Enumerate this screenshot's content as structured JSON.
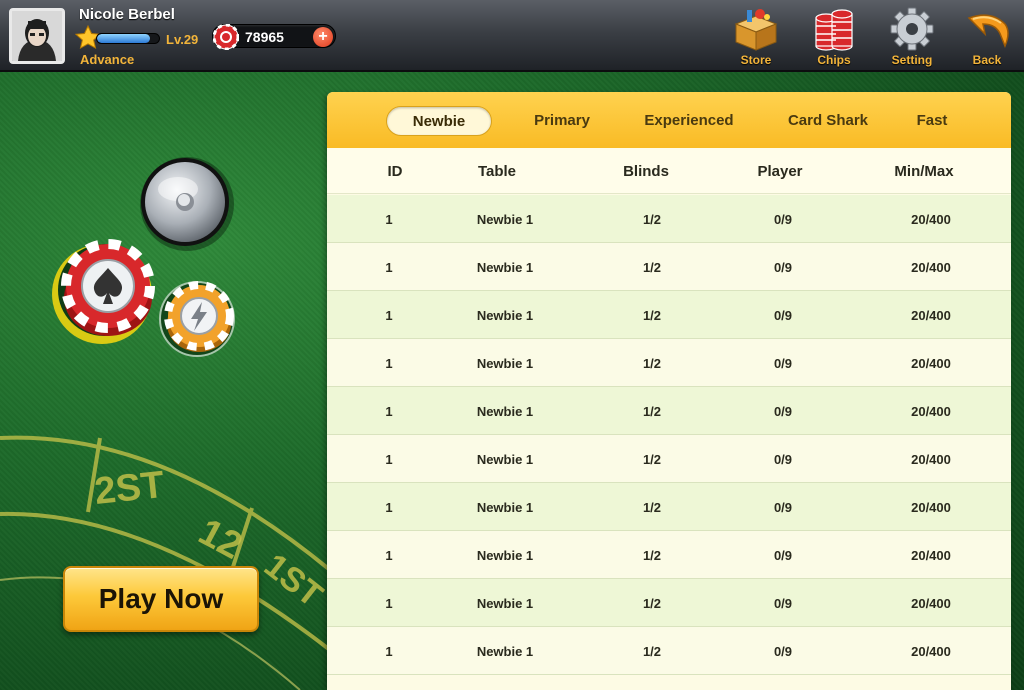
{
  "player": {
    "name": "Nicole Berbel",
    "level": "Lv.29",
    "rank": "Advance",
    "xp_fraction": 0.85,
    "chips": "78965",
    "add_chips": "+"
  },
  "nav": {
    "store": "Store",
    "chips": "Chips",
    "setting": "Setting",
    "back": "Back"
  },
  "play_now": "Play Now",
  "table_markings": {
    "dozen": "2ST",
    "range": "12",
    "first": "1ST"
  },
  "tabs": [
    "Newbie",
    "Primary",
    "Experienced",
    "Card Shark",
    "Fast"
  ],
  "active_tab": "Newbie",
  "columns": {
    "id": "ID",
    "table": "Table",
    "blinds": "Blinds",
    "player": "Player",
    "minmax": "Min/Max"
  },
  "rows": [
    {
      "id": "1",
      "table": "Newbie 1",
      "blinds": "1/2",
      "player": "0/9",
      "minmax": "20/400"
    },
    {
      "id": "1",
      "table": "Newbie 1",
      "blinds": "1/2",
      "player": "0/9",
      "minmax": "20/400"
    },
    {
      "id": "1",
      "table": "Newbie 1",
      "blinds": "1/2",
      "player": "0/9",
      "minmax": "20/400"
    },
    {
      "id": "1",
      "table": "Newbie 1",
      "blinds": "1/2",
      "player": "0/9",
      "minmax": "20/400"
    },
    {
      "id": "1",
      "table": "Newbie 1",
      "blinds": "1/2",
      "player": "0/9",
      "minmax": "20/400"
    },
    {
      "id": "1",
      "table": "Newbie 1",
      "blinds": "1/2",
      "player": "0/9",
      "minmax": "20/400"
    },
    {
      "id": "1",
      "table": "Newbie 1",
      "blinds": "1/2",
      "player": "0/9",
      "minmax": "20/400"
    },
    {
      "id": "1",
      "table": "Newbie 1",
      "blinds": "1/2",
      "player": "0/9",
      "minmax": "20/400"
    },
    {
      "id": "1",
      "table": "Newbie 1",
      "blinds": "1/2",
      "player": "0/9",
      "minmax": "20/400"
    },
    {
      "id": "1",
      "table": "Newbie 1",
      "blinds": "1/2",
      "player": "0/9",
      "minmax": "20/400"
    }
  ],
  "icons": {
    "store": "box-icon",
    "chips": "chip-stack-icon",
    "setting": "gear-icon",
    "back": "back-arrow-icon",
    "bell": "service-bell-icon",
    "play": "spade-chip-icon",
    "fast": "lightning-chip-icon"
  },
  "colors": {
    "accent": "#f2b43a",
    "felt": "#1e6c2b",
    "tab_bar": "#f9bb25"
  }
}
